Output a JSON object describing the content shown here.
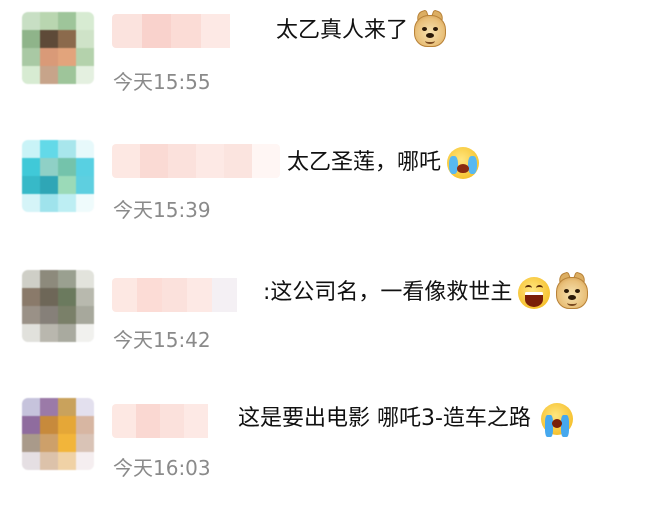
{
  "comments": [
    {
      "text": "太乙真人来了",
      "emojis": [
        "doge-icon"
      ],
      "time": "今天15:55",
      "avatar_colors": [
        "#c8dfc4",
        "#b9d6b0",
        "#9ec59a",
        "#d7ebd2",
        "#8fb48a",
        "#5e4a38",
        "#8b6a4c",
        "#cfe3c8",
        "#a9c9a4",
        "#d99a78",
        "#e2a47c",
        "#b4d2ac",
        "#d7ebd2",
        "#c7a48a",
        "#9ec59a",
        "#e4f0e0"
      ],
      "name_colors": [
        "#fbe3de",
        "#f9d2cc",
        "#fbdcd6",
        "#fde9e5",
        "#ffffff"
      ]
    },
    {
      "text": "太乙圣莲，哪吒",
      "emojis": [
        "crying-laughing-icon"
      ],
      "time": "今天15:39",
      "avatar_colors": [
        "#c9f3f7",
        "#63d9e8",
        "#a8e6ec",
        "#e7f9fb",
        "#40c9d8",
        "#8fd0c6",
        "#74c3ab",
        "#58d0e2",
        "#37b9c8",
        "#2fa6b6",
        "#9bdab8",
        "#5ecfe0",
        "#d5f4f8",
        "#9fe3ec",
        "#bdeef3",
        "#effbfc"
      ],
      "name_colors": [
        "#fde8e3",
        "#fadad4",
        "#fbe1dc",
        "#fde9e5",
        "#fbe4df",
        "#fff6f4"
      ]
    },
    {
      "text": ":这公司名，一看像救世主",
      "emojis": [
        "laughing-icon",
        "doge-icon"
      ],
      "time": "今天15:42",
      "avatar_colors": [
        "#cfcfc7",
        "#8d8a7c",
        "#9aa090",
        "#e2e3dc",
        "#8a7a6a",
        "#6e6758",
        "#6b7a5e",
        "#b8b9ae",
        "#9a9187",
        "#868079",
        "#7a8069",
        "#a7a89c",
        "#e1e1dc",
        "#b9b7ae",
        "#a9aa9f",
        "#f1f1ee"
      ],
      "name_colors": [
        "#fde8e3",
        "#fcdcd6",
        "#fbe1dc",
        "#fde9e5",
        "#f4f0f4",
        "#ffffff"
      ]
    },
    {
      "text": "这是要出电影 哪吒3-造车之路",
      "emojis": [
        "sobbing-icon"
      ],
      "time": "今天16:03",
      "avatar_colors": [
        "#c6c3dc",
        "#9b7aa8",
        "#c9a25c",
        "#e3e0ee",
        "#8f6c9e",
        "#c78a3c",
        "#e5a737",
        "#d7b6a2",
        "#a99a8a",
        "#cda06a",
        "#f2b53a",
        "#d9c3b6",
        "#e5dfe3",
        "#dcc2aa",
        "#f0d2a6",
        "#f5eef0"
      ],
      "name_colors": [
        "#fde8e3",
        "#fad8d2",
        "#fbe1dc",
        "#fde9e5",
        "#ffffff"
      ]
    }
  ]
}
